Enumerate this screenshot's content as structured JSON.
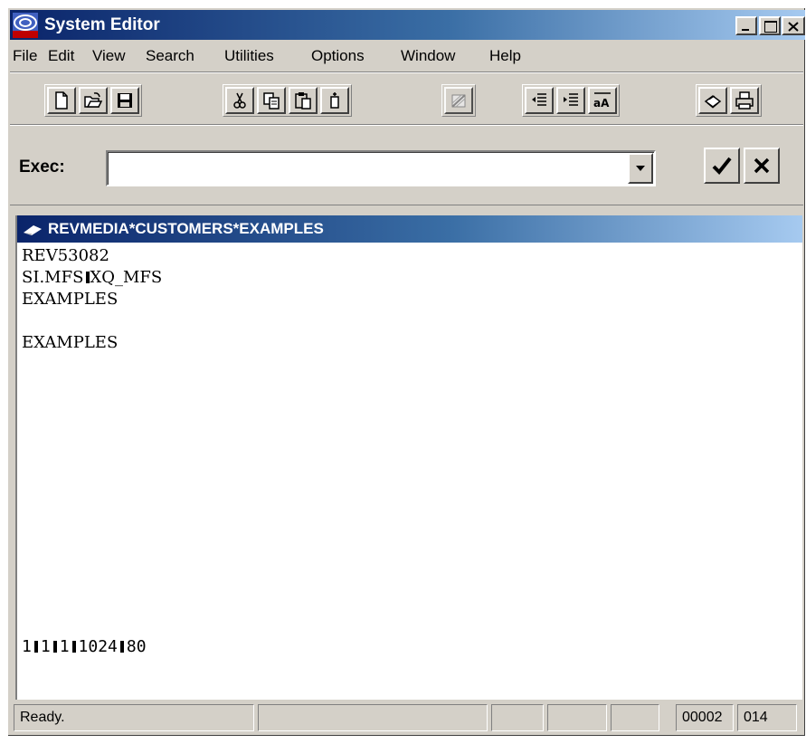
{
  "window": {
    "title": "System Editor"
  },
  "menu": [
    "File",
    "Edit",
    "View",
    "Search",
    "Utilities",
    "Options",
    "Window",
    "Help"
  ],
  "toolbar": {
    "groups": [
      [
        "new-file-icon",
        "open-folder-icon",
        "save-disk-icon"
      ],
      [
        "cut-scissors-icon",
        "copy-icon",
        "paste-icon",
        "insert-icon"
      ],
      [
        "compile-icon"
      ],
      [
        "outdent-icon",
        "indent-icon",
        "case-convert-icon"
      ],
      [
        "print-setup-icon",
        "printer-icon"
      ]
    ]
  },
  "exec": {
    "label": "Exec:",
    "value": "",
    "ok_icon": "checkmark-icon",
    "cancel_icon": "x-close-icon"
  },
  "document": {
    "title": "REVMEDIA*CUSTOMERS*EXAMPLES",
    "lines": [
      "REV53082",
      [
        "SI.MFS",
        "XQ_MFS"
      ],
      "EXAMPLES",
      "",
      "EXAMPLES"
    ],
    "last_line": [
      "1",
      "1",
      "1",
      "1024",
      "80"
    ]
  },
  "status": {
    "text": "Ready.",
    "line": "00002",
    "col": "014"
  }
}
